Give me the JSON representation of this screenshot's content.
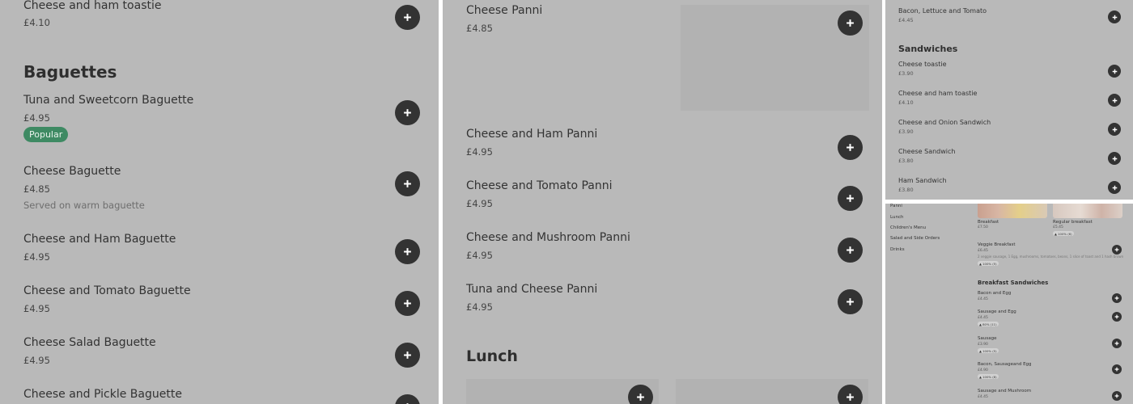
{
  "panel1": {
    "top_item": {
      "name": "Cheese and ham toastie",
      "price": "£4.10"
    },
    "section_title": "Baguettes",
    "items": [
      {
        "name": "Tuna and Sweetcorn Baguette",
        "price": "£4.95",
        "badge": "Popular"
      },
      {
        "name": "Cheese Baguette",
        "price": "£4.85",
        "description": "Served on warm baguette"
      },
      {
        "name": "Cheese and Ham Baguette",
        "price": "£4.95"
      },
      {
        "name": "Cheese and Tomato Baguette",
        "price": "£4.95"
      },
      {
        "name": "Cheese Salad Baguette",
        "price": "£4.95"
      },
      {
        "name": "Cheese and Pickle Baguette",
        "price": ""
      }
    ]
  },
  "panel2": {
    "items": [
      {
        "name": "Cheese Panni",
        "price": "£4.85"
      },
      {
        "name": "Cheese and Ham Panni",
        "price": "£4.95"
      },
      {
        "name": "Cheese and Tomato Panni",
        "price": "£4.95"
      },
      {
        "name": "Cheese and Mushroom Panni",
        "price": "£4.95"
      },
      {
        "name": "Tuna and Cheese Panni",
        "price": "£4.95"
      }
    ],
    "section_title": "Lunch"
  },
  "panel3": {
    "top_item": {
      "name": "Bacon, Lettuce and Tomato",
      "price": "£4.45"
    },
    "section_title": "Sandwiches",
    "items": [
      {
        "name": "Cheese toastie",
        "price": "£3.90"
      },
      {
        "name": "Cheese and ham toastie",
        "price": "£4.10"
      },
      {
        "name": "Cheese and Onion Sandwich",
        "price": "£3.90"
      },
      {
        "name": "Cheese Sandwich",
        "price": "£3.80"
      },
      {
        "name": "Ham Sandwich",
        "price": "£3.80"
      }
    ]
  },
  "panel4": {
    "nav": [
      "Panni",
      "Lunch",
      "Children's Menu",
      "Salad and Side Orders",
      "Drinks"
    ],
    "cards": [
      {
        "name": "Breakfast",
        "price": "£7.50"
      },
      {
        "name": "Regular breakfast",
        "price": "£5.45",
        "badge": "100% (6)"
      }
    ],
    "veggie": {
      "name": "Veggie Breakfast",
      "price": "£6.45",
      "description": "2 veggie sausage, 1 Egg, mushrooms, tomatoes, beans, 1 slice of toast and 1 hash brown",
      "badge": "100% (5)"
    },
    "section_title": "Breakfast Sandwiches",
    "items": [
      {
        "name": "Bacon and Egg",
        "price": "£4.45"
      },
      {
        "name": "Sausage and Egg",
        "price": "£4.45",
        "badge": "80% (11)"
      },
      {
        "name": "Sausage",
        "price": "£3.90",
        "badge": "100% (5)"
      },
      {
        "name": "Bacon, Sausageand Egg",
        "price": "£4.90",
        "badge": "100% (8)"
      },
      {
        "name": "Sausage and Mushroom",
        "price": "£4.45"
      }
    ]
  },
  "colors": {
    "panel_bg": "#b9b9b9",
    "button": "#333333",
    "popular_badge": "#3e8a63"
  },
  "icons": {
    "add": "plus-icon",
    "rating": "thumbs-up-icon"
  }
}
